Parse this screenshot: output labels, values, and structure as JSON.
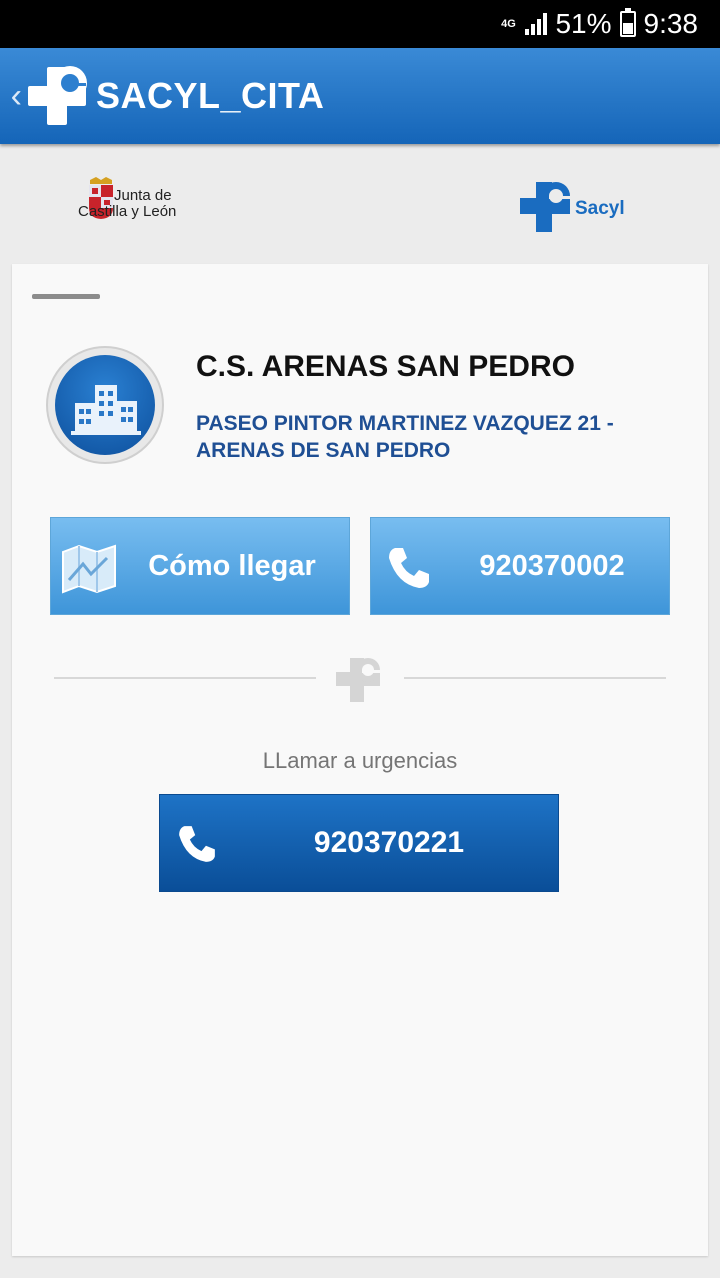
{
  "status_bar": {
    "network": "4G",
    "battery": "51%",
    "time": "9:38"
  },
  "app_bar": {
    "back_glyph": "‹",
    "title": "SACYL_CITA"
  },
  "logos": {
    "jcyl_line1": "Junta de",
    "jcyl_line2": "Castilla y León",
    "sacyl": "Sacyl"
  },
  "center": {
    "name": "C.S. ARENAS SAN PEDRO",
    "address": "PASEO PINTOR MARTINEZ VAZQUEZ 21 - ARENAS DE SAN PEDRO"
  },
  "actions": {
    "directions_label": "Cómo llegar",
    "phone": "920370002"
  },
  "emergency": {
    "label": "LLamar a urgencias",
    "phone": "920370221"
  },
  "icons": [
    "back-icon",
    "sacyl-cross-icon",
    "jcyl-shield-icon",
    "health-center-icon",
    "map-icon",
    "phone-icon",
    "signal-icon",
    "battery-icon"
  ],
  "colors": {
    "app_bar": "#1565b8",
    "button_light": "#3e95d9",
    "button_dark": "#0a4e98",
    "address_text": "#1f4f94"
  }
}
